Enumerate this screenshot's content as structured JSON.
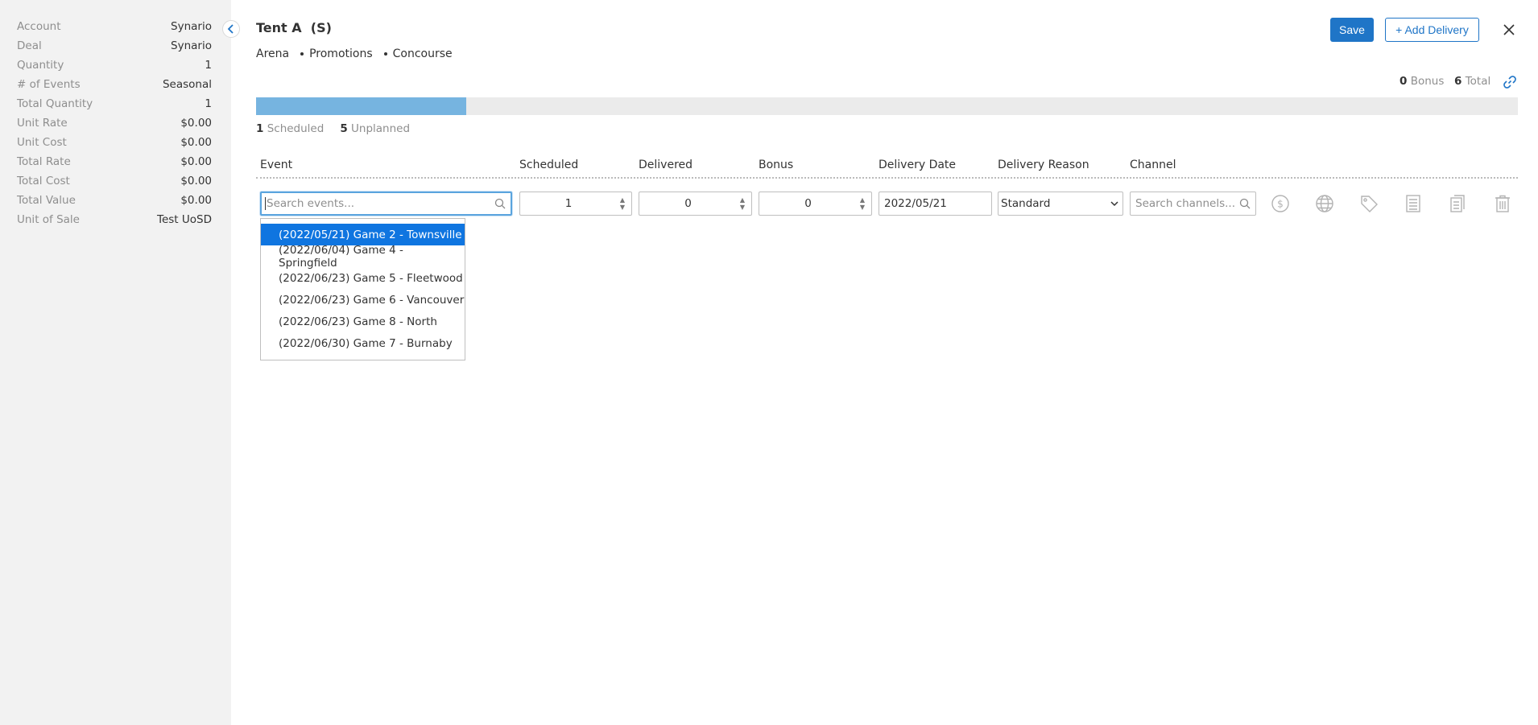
{
  "sidebar": {
    "rows": [
      {
        "label": "Account",
        "value": "Synario"
      },
      {
        "label": "Deal",
        "value": "Synario"
      },
      {
        "label": "Quantity",
        "value": "1"
      },
      {
        "label": "# of Events",
        "value": "Seasonal"
      },
      {
        "label": "Total Quantity",
        "value": "1"
      },
      {
        "label": "Unit Rate",
        "value": "$0.00"
      },
      {
        "label": "Unit Cost",
        "value": "$0.00"
      },
      {
        "label": "Total Rate",
        "value": "$0.00"
      },
      {
        "label": "Total Cost",
        "value": "$0.00"
      },
      {
        "label": "Total Value",
        "value": "$0.00"
      },
      {
        "label": "Unit of Sale",
        "value": "Test UoSD"
      }
    ]
  },
  "header": {
    "title": "Tent A  (S)",
    "breadcrumbs": [
      "Arena",
      "Promotions",
      "Concourse"
    ],
    "save_label": "Save",
    "add_delivery_label": "+ Add Delivery"
  },
  "totals": {
    "bonus_count": "0",
    "bonus_label": "Bonus",
    "total_count": "6",
    "total_label": "Total"
  },
  "progress": {
    "scheduled_fraction": 0.1667,
    "fill_color": "#76b4e0",
    "scheduled_count": "1",
    "scheduled_label": "Scheduled",
    "unplanned_count": "5",
    "unplanned_label": "Unplanned"
  },
  "table": {
    "columns": [
      "Event",
      "Scheduled",
      "Delivered",
      "Bonus",
      "Delivery Date",
      "Delivery Reason",
      "Channel"
    ],
    "row": {
      "event_placeholder": "Search events...",
      "scheduled": "1",
      "delivered": "0",
      "bonus": "0",
      "delivery_date": "2022/05/21",
      "delivery_reason": "Standard",
      "channel_placeholder": "Search channels..."
    }
  },
  "event_options": [
    "(2022/05/21) Game 2 - Townsville",
    "(2022/06/04) Game 4 - Springfield",
    "(2022/06/23) Game 5 - Fleetwood",
    "(2022/06/23) Game 6 - Vancouver",
    "(2022/06/23) Game 8 - North",
    "(2022/06/30) Game 7 - Burnaby"
  ],
  "selected_option_index": 0,
  "colors": {
    "accent": "#1f75c7",
    "selected_option": "#0f75e0",
    "sidebar_bg": "#f2f2f2"
  }
}
